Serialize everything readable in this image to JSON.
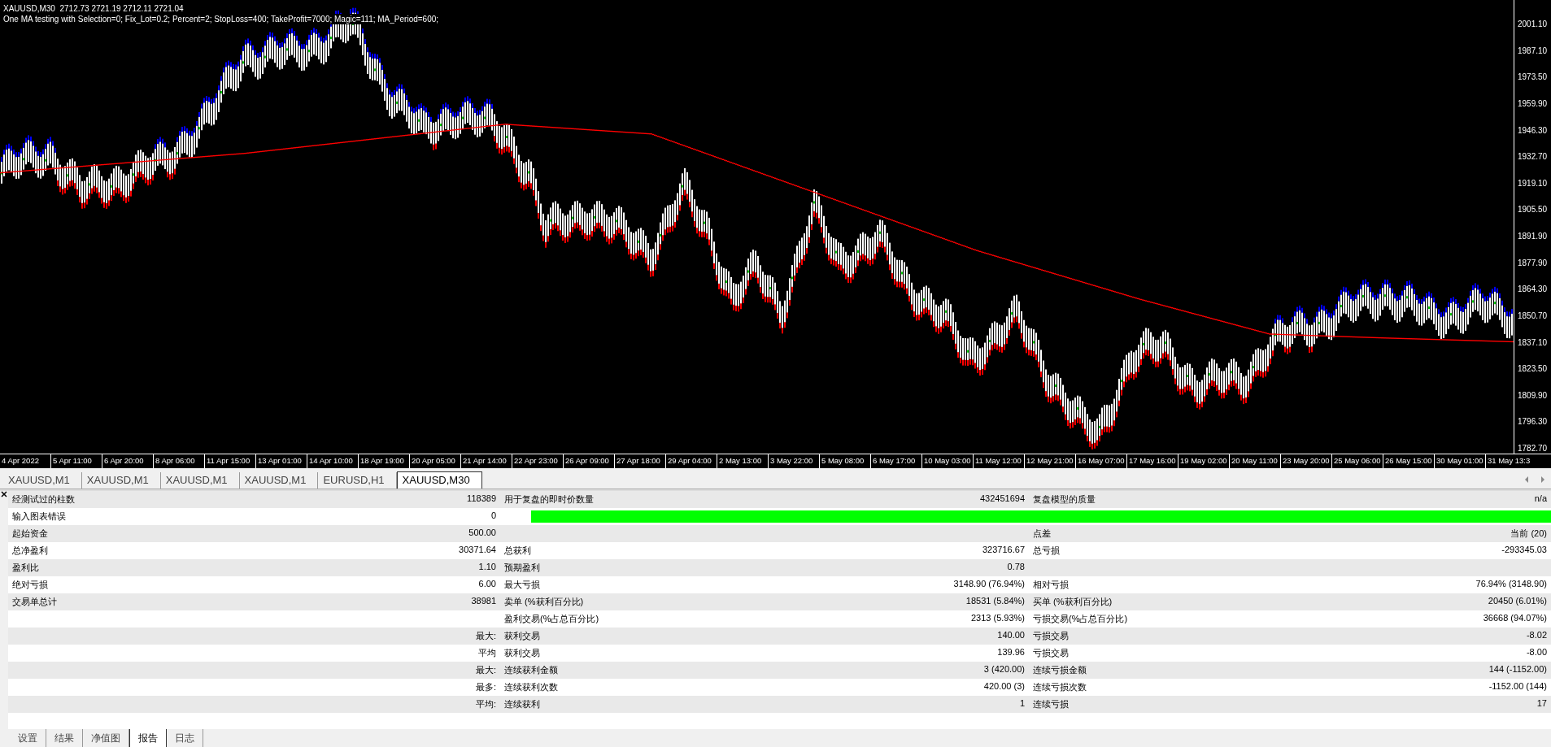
{
  "chart": {
    "symbol_line": "XAUUSD,M30  2712.73 2721.19 2712.11 2721.04",
    "expert_line": "One MA testing with Selection=0; Fix_Lot=0.2; Percent=2; StopLoss=400; TakeProfit=7000; Magic=111; MA_Period=600;",
    "price_labels": [
      "2001.10",
      "1987.10",
      "1973.50",
      "1959.90",
      "1946.30",
      "1932.70",
      "1919.10",
      "1905.50",
      "1891.90",
      "1877.90",
      "1864.30",
      "1850.70",
      "1837.10",
      "1823.50",
      "1809.90",
      "1796.30",
      "1782.70"
    ],
    "time_labels": [
      "4 Apr 2022",
      "5 Apr 11:00",
      "6 Apr 20:00",
      "8 Apr 06:00",
      "11 Apr 15:00",
      "13 Apr 01:00",
      "14 Apr 10:00",
      "18 Apr 19:00",
      "20 Apr 05:00",
      "21 Apr 14:00",
      "22 Apr 23:00",
      "26 Apr 09:00",
      "27 Apr 18:00",
      "29 Apr 04:00",
      "2 May 13:00",
      "3 May 22:00",
      "5 May 08:00",
      "6 May 17:00",
      "10 May 03:00",
      "11 May 12:00",
      "12 May 21:00",
      "16 May 07:00",
      "17 May 16:00",
      "19 May 02:00",
      "20 May 11:00",
      "23 May 20:00",
      "25 May 06:00",
      "26 May 15:00",
      "30 May 01:00",
      "31 May 13:3"
    ]
  },
  "chart_tabs": [
    {
      "label": "XAUUSD,M1",
      "selected": false
    },
    {
      "label": "XAUUSD,M1",
      "selected": false
    },
    {
      "label": "XAUUSD,M1",
      "selected": false
    },
    {
      "label": "XAUUSD,M1",
      "selected": false
    },
    {
      "label": "EURUSD,H1",
      "selected": false
    },
    {
      "label": "XAUUSD,M30",
      "selected": true
    }
  ],
  "report": {
    "rows": [
      {
        "cells": [
          {
            "label": "经测试过的柱数",
            "value": "118389"
          },
          {
            "label": "用于复盘的即时价数量",
            "value": "432451694"
          },
          {
            "label": "复盘模型的质量",
            "value": "n/a"
          }
        ]
      },
      {
        "cells": [
          {
            "label": "输入图表错误",
            "value": "0"
          }
        ],
        "quality_bar": {
          "level": 1
        }
      },
      {
        "cells": [
          {
            "label": "起始资金",
            "value": "500.00"
          },
          {},
          {
            "label": "点差",
            "value": "当前 (20)"
          }
        ]
      },
      {
        "cells": [
          {
            "label": "总净盈利",
            "value": "30371.64"
          },
          {
            "label": "总获利",
            "value": "323716.67"
          },
          {
            "label": "总亏损",
            "value": "-293345.03"
          }
        ]
      },
      {
        "cells": [
          {
            "label": "盈利比",
            "value": "1.10"
          },
          {
            "label": "预期盈利",
            "value": "0.78"
          },
          {}
        ]
      },
      {
        "cells": [
          {
            "label": "绝对亏损",
            "value": "6.00"
          },
          {
            "label": "最大亏损",
            "value": "3148.90 (76.94%)"
          },
          {
            "label": "相对亏损",
            "value": "76.94% (3148.90)"
          }
        ]
      },
      {
        "cells": [
          {
            "label": "交易单总计",
            "value": "38981"
          },
          {
            "label": "卖单 (%获利百分比)",
            "value": "18531 (5.84%)"
          },
          {
            "label": "买单 (%获利百分比)",
            "value": "20450 (6.01%)"
          }
        ]
      },
      {
        "cells": [
          {},
          {
            "label": "盈利交易(%占总百分比)",
            "value": "2313 (5.93%)"
          },
          {
            "label": "亏损交易(%占总百分比)",
            "value": "36668 (94.07%)"
          }
        ]
      },
      {
        "cells": [
          {
            "value": "最大:"
          },
          {
            "label": "获利交易",
            "value": "140.00"
          },
          {
            "label": "亏损交易",
            "value": "-8.02"
          }
        ]
      },
      {
        "cells": [
          {
            "value": "平均"
          },
          {
            "label": "获利交易",
            "value": "139.96"
          },
          {
            "label": "亏损交易",
            "value": "-8.00"
          }
        ]
      },
      {
        "cells": [
          {
            "value": "最大:"
          },
          {
            "label": "连续获利金额",
            "value": "3 (420.00)"
          },
          {
            "label": "连续亏损金额",
            "value": "144 (-1152.00)"
          }
        ]
      },
      {
        "cells": [
          {
            "value": "最多:"
          },
          {
            "label": "连续获利次数",
            "value": "420.00 (3)"
          },
          {
            "label": "连续亏损次数",
            "value": "-1152.00 (144)"
          }
        ]
      },
      {
        "cells": [
          {
            "value": "平均:"
          },
          {
            "label": "连续获利",
            "value": "1"
          },
          {
            "label": "连续亏损",
            "value": "17"
          }
        ]
      }
    ]
  },
  "tester_tabs": [
    {
      "label": "设置",
      "selected": false
    },
    {
      "label": "结果",
      "selected": false
    },
    {
      "label": "净值图",
      "selected": false
    },
    {
      "label": "报告",
      "selected": true
    },
    {
      "label": "日志",
      "selected": false
    }
  ]
}
